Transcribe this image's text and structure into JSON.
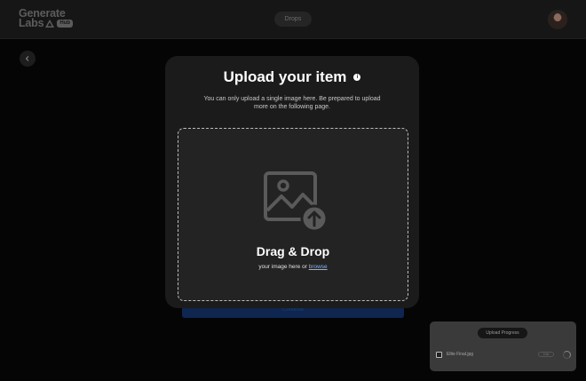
{
  "header": {
    "logo_line1": "Generate",
    "logo_line2": "Labs",
    "logo_badge": "Hub",
    "nav_pill": "Drops"
  },
  "modal": {
    "title": "Upload your item",
    "info_icon_label": "i",
    "description": "You can only upload a single image here.  Be prepared to upload more on the following page.",
    "dropzone": {
      "title": "Drag & Drop",
      "subtitle_prefix": "your image here or ",
      "browse_link": "browse"
    }
  },
  "background": {
    "continue_label": "Continue"
  },
  "upload_progress": {
    "title": "Upload Progress",
    "file_name": "Elite Final.jpg",
    "file_status": "0 kb"
  },
  "icons": {
    "back": "chevron-left-icon",
    "info": "info-icon",
    "image_upload": "image-upload-icon",
    "file": "file-icon",
    "spinner": "spinner-icon"
  }
}
